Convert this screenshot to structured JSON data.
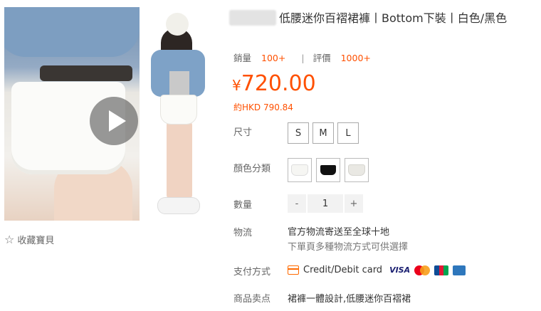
{
  "product": {
    "title": "低腰迷你百褶裙褲丨Bottom下裝丨白色/黑色"
  },
  "stats": {
    "sales_label": "銷量",
    "sales_value": "100+",
    "reviews_label": "評價",
    "reviews_value": "1000+"
  },
  "price": {
    "currency": "¥",
    "amount": "720.00",
    "converted": "約HKD 790.84"
  },
  "size": {
    "label": "尺寸",
    "options": [
      "S",
      "M",
      "L"
    ]
  },
  "color": {
    "label": "顏色分類",
    "swatches": [
      "#f6f6f3",
      "#111111",
      "#e9e8e3"
    ]
  },
  "quantity": {
    "label": "數量",
    "minus": "-",
    "value": "1",
    "plus": "+"
  },
  "logistics": {
    "label": "物流",
    "line1": "官方物流寄送至全球十地",
    "line2": "下單頁多種物流方式可供選擇"
  },
  "payment": {
    "label": "支付方式",
    "method": "Credit/Debit card",
    "visa": "VISA"
  },
  "highlights": {
    "label": "商品卖点",
    "text": "裙褲一體設計,低腰迷你百褶裙"
  },
  "favorite": {
    "label": "收藏寶貝"
  },
  "colors": {
    "accent": "#ff5000"
  }
}
